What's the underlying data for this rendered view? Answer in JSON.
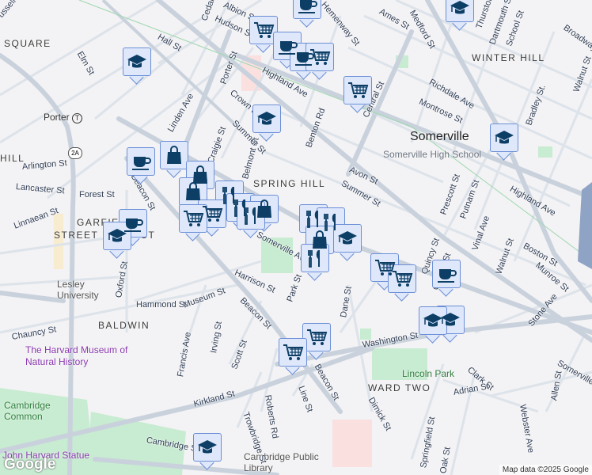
{
  "colors": {
    "road": "#d3dbe3",
    "major_road": "#c6cfd8",
    "park": "#c8ecd1",
    "highway": "#8fa3c4",
    "marker_fill": "#dfe8fb",
    "marker_border": "#6b8fd6",
    "icon": "#0d3f66"
  },
  "districts": {
    "square": "SQUARE",
    "hill_left": "HILL",
    "winter_hill": "WINTER HILL",
    "spring_hill": "SPRING HILL",
    "garfield_1": "GARFIELD",
    "garfield_2": "STREET DISTRICT",
    "baldwin": "BALDWIN",
    "ward_two": "WARD TWO"
  },
  "city": "Somerville",
  "pois": {
    "high_school": "Somerville High School",
    "porter": "Porter",
    "lesley": "Lesley University",
    "harvard_museum": "The Harvard Museum of Natural History",
    "lincoln_park": "Lincoln Park",
    "cambridge_common": "Cambridge Common",
    "john_harvard": "John Harvard Statue",
    "library": "Cambridge Public Library",
    "route": "2A"
  },
  "streets": {
    "russell": "ussell St",
    "elm": "Elm St",
    "hall": "Hall St",
    "cedar": "Cedar St",
    "albion": "Albion St",
    "hudson": "Hudson St",
    "porter_st": "Porter St",
    "crown": "Crown St",
    "linden": "Linden Ave",
    "arlington": "Arlington St",
    "lancaster": "Lancaster St",
    "forest": "Forest St",
    "linnaean": "Linnaean St",
    "craigie": "Craigie St",
    "belmont": "Belmont St",
    "summer1": "Summer St",
    "highland1": "Highland Ave",
    "benton": "Benton Rd",
    "central": "Central St",
    "ames": "Ames St",
    "medford": "Medford St",
    "thurston": "Thurston St",
    "dartmouth": "Dartmouth St",
    "school": "School St",
    "broadway": "Broadway",
    "richdale": "Richdale Ave",
    "montrose": "Montrose St",
    "bradley": "Bradley St.",
    "walnut1": "Walnut St",
    "avon": "Avon St",
    "summer2": "Summer St",
    "prescott": "Prescott St",
    "putnam": "Putnam St",
    "highland2": "Highland Ave",
    "vinal": "Vinal Ave",
    "walnut2": "Walnut St",
    "boston": "Boston St",
    "munroe": "Munroe St",
    "stone": "Stone Ave",
    "quincy": "Quincy St",
    "church": "Church St",
    "somerville_ave": "Somerville Ave",
    "beacon1": "Beacon St",
    "oxford": "Oxford St",
    "hammond": "Hammond St",
    "museum": "Museum St",
    "harrison": "Harrison St",
    "park": "Park St",
    "beacon2": "Beacon St",
    "chauncy": "Chauncy St",
    "irving": "Irving St",
    "francis": "Francis Ave",
    "scott": "Scott St",
    "dane": "Dane St",
    "washington": "Washington St",
    "beacon3": "Beacon St",
    "clark": "Clark St",
    "adrian": "Adrian St",
    "allen": "Allen St",
    "webster": "Webster Ave",
    "somerville_ave2": "Somerville",
    "kirkland": "Kirkland St",
    "roberts": "Roberts Rd",
    "trowbridge": "Trowbridge St",
    "line": "Line St",
    "dimick": "Dimick St",
    "springfield": "Springfield St",
    "oak": "Oak St",
    "cambridge": "Cambridge St",
    "hemon": "Hemenway St"
  },
  "markers": [
    "cafe",
    "grocery",
    "cafe",
    "cafe",
    "grocery",
    "grocery",
    "education",
    "education",
    "education",
    "education",
    "cafe",
    "shopping",
    "shopping",
    "shopping",
    "restaurant",
    "grocery",
    "grocery",
    "restaurant",
    "shopping",
    "restaurant",
    "cafe",
    "education",
    "restaurant",
    "restaurant",
    "shopping",
    "education",
    "restaurant",
    "grocery",
    "grocery",
    "cafe",
    "education",
    "education",
    "grocery",
    "grocery",
    "education"
  ],
  "logo": "Google",
  "attribution": "Map data ©2025 Google"
}
